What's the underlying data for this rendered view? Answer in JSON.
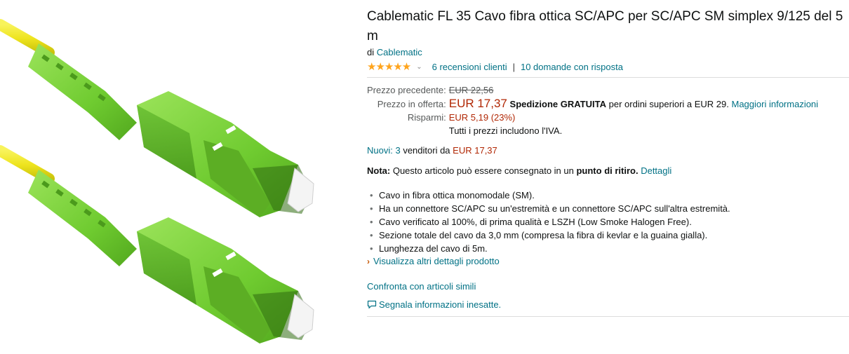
{
  "product": {
    "title": "Cablematic FL 35 Cavo fibra ottica SC/APC per SC/APC SM simplex 9/125 del 5 m",
    "by_prefix": "di",
    "brand": "Cablematic",
    "image_icon": "fiber-optic-cable-image"
  },
  "ratings": {
    "stars": "★★★★★",
    "chevron": "⌄",
    "reviews_link": "6 recensioni clienti",
    "separator": "|",
    "questions_link": "10 domande con risposta"
  },
  "price": {
    "previous_label": "Prezzo precedente:",
    "previous_value": "EUR 22,56",
    "offer_label": "Prezzo in offerta:",
    "offer_value": "EUR 17,37",
    "shipping_bold": "Spedizione GRATUITA",
    "shipping_text": "per ordini superiori a EUR 29.",
    "shipping_link": "Maggiori informazioni",
    "savings_label": "Risparmi:",
    "savings_value": "EUR 5,19 (23%)",
    "vat_note": "Tutti i prezzi includono l'IVA."
  },
  "offers": {
    "new_link": "Nuovi: 3",
    "sellers_text": "venditori da",
    "from_price": "EUR 17,37"
  },
  "note": {
    "label": "Nota:",
    "text": "Questo articolo può essere consegnato in un",
    "bold": "punto di ritiro.",
    "link": "Dettagli"
  },
  "bullets": [
    "Cavo in fibra ottica monomodale (SM).",
    "Ha un connettore SC/APC su un'estremità e un connettore SC/APC sull'altra estremità.",
    "Cavo verificato al 100%, di prima qualità e LSZH (Low Smoke Halogen Free).",
    "Sezione totale del cavo da 3,0 mm (compresa la fibra di kevlar e la guaina gialla).",
    "Lunghezza del cavo di 5m."
  ],
  "bullet_glyph": "•",
  "more_details": {
    "arrow": "›",
    "link": "Visualizza altri dettagli prodotto"
  },
  "compare_link": "Confronta con articoli simili",
  "report": {
    "icon": "speech-bubble-icon",
    "link": "Segnala informazioni inesatte."
  },
  "colors": {
    "link": "#007185",
    "price": "#b12704",
    "star": "#ffa41c",
    "connector_green": "#7ad33a",
    "cable_yellow": "#f2ee2a"
  }
}
